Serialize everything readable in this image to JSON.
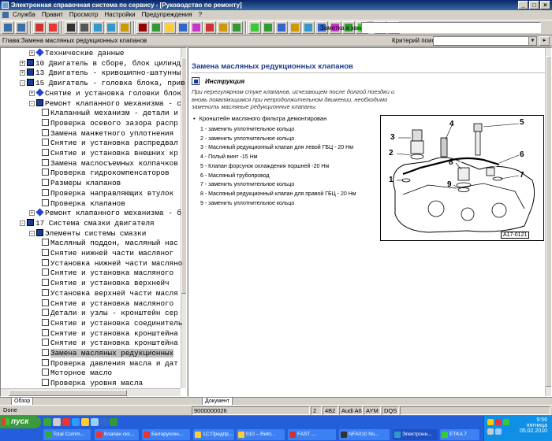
{
  "window": {
    "title": "Электронная справочная система по сервису - [Руководство по ремонту]",
    "buttons": [
      "_",
      "□",
      "×"
    ]
  },
  "menu": [
    "Служба",
    "Правит",
    "Просмотр",
    "Настройки",
    "Предупреждения",
    "?"
  ],
  "toolbar": {
    "note_label": "Заметка к заказу:",
    "buttons": [
      "back-icon",
      "forward-icon",
      "separator",
      "home-icon",
      "stop-icon",
      "separator",
      "print-icon",
      "print2-icon",
      "prev-icon",
      "next-icon",
      "bookmark-icon",
      "separator",
      "vag-icon",
      "fuel-icon",
      "settings-icon",
      "book-icon",
      "mark-icon",
      "flag-icon",
      "settings2-icon",
      "close-icon",
      "separator",
      "tool1-icon",
      "tool2-icon",
      "tool3-icon",
      "tool4-icon",
      "tool5-icon",
      "tool6-icon",
      "tool7-icon",
      "tool8-icon",
      "tool9-icon",
      "separator",
      "tool10-icon",
      "tool11-icon"
    ]
  },
  "pathbar": {
    "path": "Глава:Замена масляных редукционных клапанов",
    "criteria_label": "Критерий поиска:"
  },
  "tree": {
    "items": [
      {
        "label": "Технические данные",
        "indent": 3,
        "toggle": "+",
        "icon": "diamond"
      },
      {
        "label": "10 Двигатель в сборе, блок цилинд",
        "indent": 2,
        "toggle": "+",
        "icon": "book"
      },
      {
        "label": "13 Двигатель - кривошипно-шатунны",
        "indent": 2,
        "toggle": "+",
        "icon": "book"
      },
      {
        "label": "15 Двигатель - головка блока, прив",
        "indent": 2,
        "toggle": "-",
        "icon": "book"
      },
      {
        "label": "Снятие и установка головки блок",
        "indent": 3,
        "toggle": "+",
        "icon": "diamond"
      },
      {
        "label": "Ремонт клапанного механизма - с",
        "indent": 3,
        "toggle": "-",
        "icon": "book"
      },
      {
        "label": "Клапанный механизм - детали и",
        "indent": 4,
        "toggle": "",
        "icon": "doc"
      },
      {
        "label": "Проверка осевого зазора распр",
        "indent": 4,
        "toggle": "",
        "icon": "doc"
      },
      {
        "label": "Замена манжетного уплотнения",
        "indent": 4,
        "toggle": "",
        "icon": "doc"
      },
      {
        "label": "Снятие и установка распредвал",
        "indent": 4,
        "toggle": "",
        "icon": "doc"
      },
      {
        "label": "Снятие и установка внешних кр",
        "indent": 4,
        "toggle": "",
        "icon": "doc"
      },
      {
        "label": "Замена маслосъемных колпачков",
        "indent": 4,
        "toggle": "",
        "icon": "doc"
      },
      {
        "label": "Проверка гидрокомпенсаторов",
        "indent": 4,
        "toggle": "",
        "icon": "doc"
      },
      {
        "label": "Размеры клапанов",
        "indent": 4,
        "toggle": "",
        "icon": "doc"
      },
      {
        "label": "Проверка направляющих втулок",
        "indent": 4,
        "toggle": "",
        "icon": "doc"
      },
      {
        "label": "Проверка клапанов",
        "indent": 4,
        "toggle": "",
        "icon": "doc"
      },
      {
        "label": "Ремонт клапанного механизма - б",
        "indent": 3,
        "toggle": "+",
        "icon": "diamond"
      },
      {
        "label": "17 Система смазки двигателя",
        "indent": 2,
        "toggle": "-",
        "icon": "book"
      },
      {
        "label": "Элементы системы смазки",
        "indent": 3,
        "toggle": "-",
        "icon": "book"
      },
      {
        "label": "Масляный поддон, масляный нас",
        "indent": 4,
        "toggle": "",
        "icon": "doc"
      },
      {
        "label": "Снятие нижней части масляног",
        "indent": 4,
        "toggle": "",
        "icon": "doc"
      },
      {
        "label": "Установка нижней части масляно",
        "indent": 4,
        "toggle": "",
        "icon": "doc"
      },
      {
        "label": "Снятие и установка масляного",
        "indent": 4,
        "toggle": "",
        "icon": "doc"
      },
      {
        "label": "Снятие и установка верхнейч",
        "indent": 4,
        "toggle": "",
        "icon": "doc"
      },
      {
        "label": "Установка верхней части масля",
        "indent": 4,
        "toggle": "",
        "icon": "doc"
      },
      {
        "label": "Снятие и установка масляного",
        "indent": 4,
        "toggle": "",
        "icon": "doc"
      },
      {
        "label": "Детали и узлы - кронштейн сер",
        "indent": 4,
        "toggle": "",
        "icon": "doc"
      },
      {
        "label": "Снятие и установка соединитель",
        "indent": 4,
        "toggle": "",
        "icon": "doc"
      },
      {
        "label": "Снятие и установка кронштейна",
        "indent": 4,
        "toggle": "",
        "icon": "doc"
      },
      {
        "label": "Снятие и установка кронштейна",
        "indent": 4,
        "toggle": "",
        "icon": "doc"
      },
      {
        "label": "Замена масляных редукционных",
        "indent": 4,
        "toggle": "",
        "icon": "doc",
        "selected": true
      },
      {
        "label": "Проверка давления масла и дат",
        "indent": 4,
        "toggle": "",
        "icon": "doc"
      },
      {
        "label": "Моторное масло",
        "indent": 4,
        "toggle": "",
        "icon": "doc"
      },
      {
        "label": "Проверка уровня масла",
        "indent": 4,
        "toggle": "",
        "icon": "doc"
      }
    ],
    "tab_label": "Обзор"
  },
  "document": {
    "title": "Замена масляных редукционных клапанов",
    "instruction_label": "Инструкция",
    "instruction_text": "При нерегулярном стуке клапанов, исчезающем после долгой поездки и вновь появляющимся при непродолжительном движении, необходимо заменить масляные редукционные клапаны.",
    "bullet": "Кронштейн масляного фильтра демонтирован",
    "steps": [
      "1 - заменить уплотнительное кольцо",
      "2 - заменить уплотнительное кольцо",
      "3 - Масляный редукционный клапан для левой ГБЦ - 20 Нм",
      "4 - Полый винт -15 Нм",
      "5 - Клапан форсунок охлаждения поршней -20 Нм",
      "6 - Масляный трубопровод",
      "7 - заменить уплотнительное кольцо",
      "8 - Масляный редукционный клапан для правой ГБЦ - 20 Нм",
      "9 - заменить уплотнительное кольцо"
    ],
    "figure": {
      "code": "A17-0121",
      "labels": [
        "3",
        "4",
        "5",
        "2",
        "6",
        "8",
        "7",
        "1",
        "9"
      ]
    },
    "tab_label": "Документ"
  },
  "status": {
    "state": "Done",
    "order": "9000000026",
    "cells": [
      "2",
      "4B2",
      "Audi A6",
      "AYM",
      "DQS"
    ]
  },
  "taskbar": {
    "start": "пуск",
    "tasks": [
      {
        "label": "Total Comm..."
      },
      {
        "label": "Клапан скс..."
      },
      {
        "label": "Белорусскн..."
      },
      {
        "label": "1С:Предпр..."
      },
      {
        "label": "010 – Retri..."
      },
      {
        "label": "FAST ..."
      },
      {
        "label": "NFA010 Ns..."
      },
      {
        "label": "Электронн...",
        "active": true
      },
      {
        "label": "ETKA 7"
      }
    ],
    "time": "9:56",
    "day": "пятница",
    "date": "05.02.2010"
  }
}
